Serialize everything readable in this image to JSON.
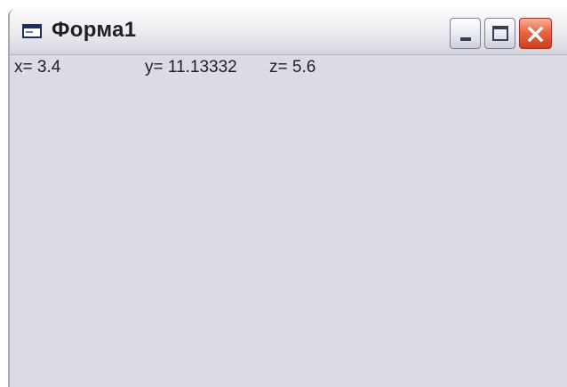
{
  "window": {
    "title": "Форма1",
    "icon": "form-icon",
    "controls": {
      "minimize": "minimize-icon",
      "maximize": "maximize-icon",
      "close": "close-icon"
    }
  },
  "output": {
    "x": "x= 3.4",
    "y": "y= 11.13332",
    "z": "z= 5.6"
  },
  "colors": {
    "client_bg": "#dcdbe5",
    "close_button": "#e9683f"
  }
}
